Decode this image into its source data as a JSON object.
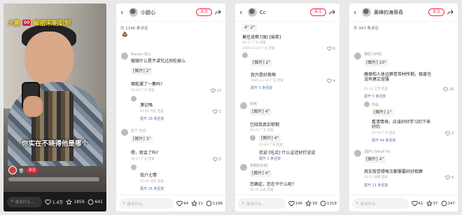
{
  "video": {
    "title_prefix": "大鹏",
    "title_tag": "00",
    "title_suffix": "解密宋朝职制",
    "subtitle": "你实在不晓得他是哪个",
    "uploader_name": "懂·",
    "follow_label": "关注",
    "input_placeholder": "说点什么...",
    "likes": "1.4万",
    "stars": "1859",
    "comments": "641"
  },
  "panel2": {
    "user_name": "小甜心",
    "follow_label": "关注",
    "comment_count": "共 1196 条评论",
    "comments": [
      {
        "name": "Steven 初心",
        "text": "做微什么是不讲究过后吃掉么",
        "like": ""
      },
      {
        "name": "",
        "text": "[图片] 2\"",
        "like": ""
      },
      {
        "name": "",
        "text": "哪乾凝了一集吗?",
        "like": "17"
      },
      {
        "name": "",
        "text": "02-06 广东  回复",
        "like": ""
      },
      {
        "name": "",
        "text": "凄记嗎",
        "like": "1"
      },
      {
        "name": "",
        "text": "02-06 河北  回复",
        "like": ""
      },
      {
        "name": "",
        "text": "展开 28 条回复",
        "like": ""
      },
      {
        "name": "五个 沙丘",
        "text": "[图片] 3\"",
        "like": ""
      },
      {
        "name": "",
        "text": "嗯，就会了吗?",
        "like": "5"
      },
      {
        "name": "",
        "text": "02-07 广东  回复",
        "like": ""
      },
      {
        "name": "",
        "text": "低六七情",
        "like": ""
      },
      {
        "name": "",
        "text": "02-06 北京  回复",
        "like": ""
      },
      {
        "name": "",
        "text": "展开 16 条回复",
        "like": ""
      }
    ],
    "input_placeholder": "说点什么...",
    "likes": "94",
    "stars": "21",
    "comments_total": "1196"
  },
  "panel3": {
    "user_name": "Cc",
    "follow_label": "关注",
    "comments": [
      {
        "text": "4\" 2\"",
        "meta": ""
      },
      {
        "text": "莫往说啊 [强] [偷笑]",
        "meta": "02-07 广东  回复"
      },
      {
        "text": "2020-12-18 广东  回复",
        "meta": ""
      },
      {
        "text": "[图片] 2\"",
        "meta": "4"
      },
      {
        "text": "我只是好笑啊",
        "meta": "2025-12-18 广东  回复"
      },
      {
        "text": "展开 5 条回复",
        "meta": "6"
      },
      {
        "text": "你死",
        "meta": ""
      },
      {
        "text": "[图片] 4\"",
        "meta": ""
      },
      {
        "text": "巳晓我真实职剩",
        "meta": "01-21 广东  回复"
      },
      {
        "text": "[图片] 4\"",
        "meta": "01-03 广东  回复"
      },
      {
        "text": "欢迎 [吃瓜] 什么证还好打说说",
        "meta": "展开 1 条回复"
      },
      {
        "text": "宋朝的东西",
        "meta": ""
      },
      {
        "text": "[图片] 4\"",
        "meta": ""
      },
      {
        "text": "您确定，您在干什么呢?",
        "meta": "01-22 山东  回复"
      }
    ],
    "input_placeholder": "说点什么...",
    "likes": "146",
    "stars": "39",
    "comments_total": "1318"
  },
  "panel4": {
    "user_name": "黄峰的海哥奇",
    "follow_label": "关注",
    "comment_count": "共 347 条评论",
    "comments": [
      {
        "text": "懂原力的吗",
        "meta": ""
      },
      {
        "text": "[图片] 10\"",
        "meta": "39"
      },
      {
        "text": "确保和人体远察卷带材所剩，极度也没有建立宣服",
        "meta": "01-31 江苏  回复"
      },
      {
        "text": "展开 5 条回复",
        "meta": "26"
      },
      {
        "text": "作品",
        "meta": ""
      },
      {
        "text": "[图片] 1\"",
        "meta": "3"
      },
      {
        "text": "看清情境，应该好好学习的下来好的",
        "meta": "02-03 广东  回复"
      },
      {
        "text": "展开 44 条回复",
        "meta": ""
      },
      {
        "text": "[图片] Small fry",
        "meta": ""
      },
      {
        "text": "[图片] 4\"",
        "meta": "6"
      },
      {
        "text": "其实我觉得每次都需要好好观察",
        "meta": "02-12 福建  回复"
      },
      {
        "text": "展开 11 条回复",
        "meta": ""
      }
    ],
    "input_placeholder": "说点什么...",
    "likes": "61",
    "stars": "37",
    "comments_total": "347"
  },
  "colors": {
    "accent": "#ff2442",
    "video_title": "#ffde2b",
    "link": "#5c7da8"
  }
}
